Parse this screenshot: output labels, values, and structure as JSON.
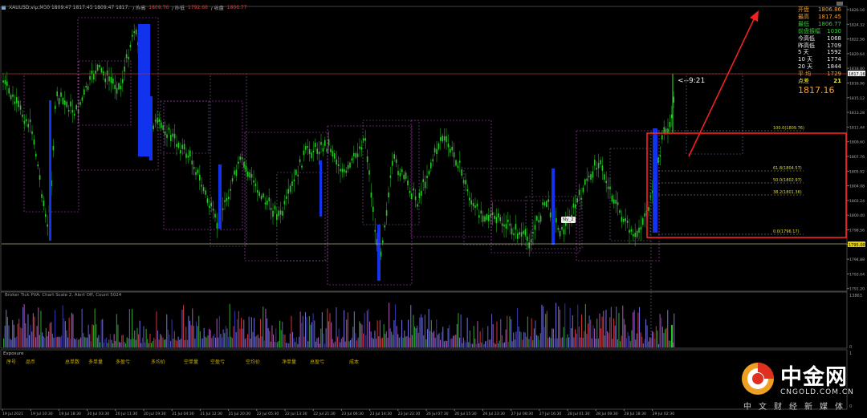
{
  "window": {
    "symbol_line": "XAUUSD,vip,M30   1809.47  1817.45  1809.47  1817.",
    "open_label": "/ 昨高",
    "open_value": "1809.76",
    "low_label": "/ 昨低",
    "low_value": "1792.66",
    "close_label": "/ 收盘",
    "close_value": "1806.77"
  },
  "info_panel": {
    "rows": [
      {
        "label": "开盘",
        "value": "1806.86",
        "color": "orange"
      },
      {
        "label": "最高",
        "value": "1817.45",
        "color": "orange"
      },
      {
        "label": "最低",
        "value": "1806.77",
        "color": "green"
      },
      {
        "label": "前盘振幅",
        "value": "1030",
        "color": "green"
      },
      {
        "label": "今高低",
        "value": "1068",
        "color": "white"
      },
      {
        "label": "昨高低",
        "value": "1709",
        "color": "white"
      },
      {
        "label": "5  天",
        "value": "1592",
        "color": "white"
      },
      {
        "label": "10  天",
        "value": "1774",
        "color": "white"
      },
      {
        "label": "20  天",
        "value": "1844",
        "color": "white"
      },
      {
        "label": "平  均",
        "value": "1729",
        "color": "orange"
      },
      {
        "label": "点差",
        "value": "21",
        "color": "yellow"
      }
    ],
    "price": "1817.16"
  },
  "countdown": "<--9:21",
  "note_label": "Ny_2",
  "price_scale": [
    "1826.16",
    "1824.32",
    "1822.56",
    "1820.64",
    "1818.80",
    "1816.96",
    "1815.12",
    "1813.28",
    "1811.44",
    "1809.60",
    "1807.76",
    "1805.92",
    "1804.08",
    "1802.24",
    "1800.40",
    "1798.56",
    "1796.72",
    "1794.88",
    "1793.04",
    "1791.20"
  ],
  "current_price_tag": "1817.16",
  "level_tag": "1795.00",
  "fib_levels": [
    {
      "label": "100.0(1809.76)"
    },
    {
      "label": "61.8(1804.57)"
    },
    {
      "label": "50.0(1802.97)"
    },
    {
      "label": "38.2(1801.36)"
    },
    {
      "label": "0.0(1796.17)"
    }
  ],
  "indicator": {
    "title": "Broker Tick PVA:  Chart Scale 2, Alert Off, Count 5024",
    "scale_top": "13863",
    "scale_bottom": "0"
  },
  "exposure": {
    "title": "Exposure",
    "columns": [
      "序号",
      "品币",
      "总单数",
      "多单量",
      "多盈亏",
      "多均价",
      "空单量",
      "空盈亏",
      "空均价",
      "净单量",
      "总盈亏",
      "成本"
    ],
    "scale_top": "1",
    "scale_bottom": "0"
  },
  "time_axis": [
    "19 Jul 2021",
    "19 Jul 10:30",
    "19 Jul 18:30",
    "20 Jul 03:30",
    "20 Jul 11:30",
    "20 Jul 19:30",
    "21 Jul 04:30",
    "21 Jul 12:30",
    "21 Jul 20:30",
    "22 Jul 05:30",
    "22 Jul 13:30",
    "22 Jul 21:30",
    "23 Jul 06:30",
    "23 Jul 14:30",
    "23 Jul 22:30",
    "26 Jul 07:30",
    "26 Jul 15:30",
    "26 Jul 23:30",
    "27 Jul 08:30",
    "27 Jul 16:30",
    "28 Jul 01:30",
    "28 Jul 09:30",
    "28 Jul 18:30",
    "29 Jul 02:30"
  ],
  "logo": {
    "name": "中金网",
    "url": "CNGOLD.COM.CN",
    "slogan": "中文财经新媒体"
  },
  "colors": {
    "bull": "#22cc22",
    "bear_block": "#1133ee",
    "box": "#c040c0",
    "grid": "#222",
    "highlight": "#ff2222"
  }
}
